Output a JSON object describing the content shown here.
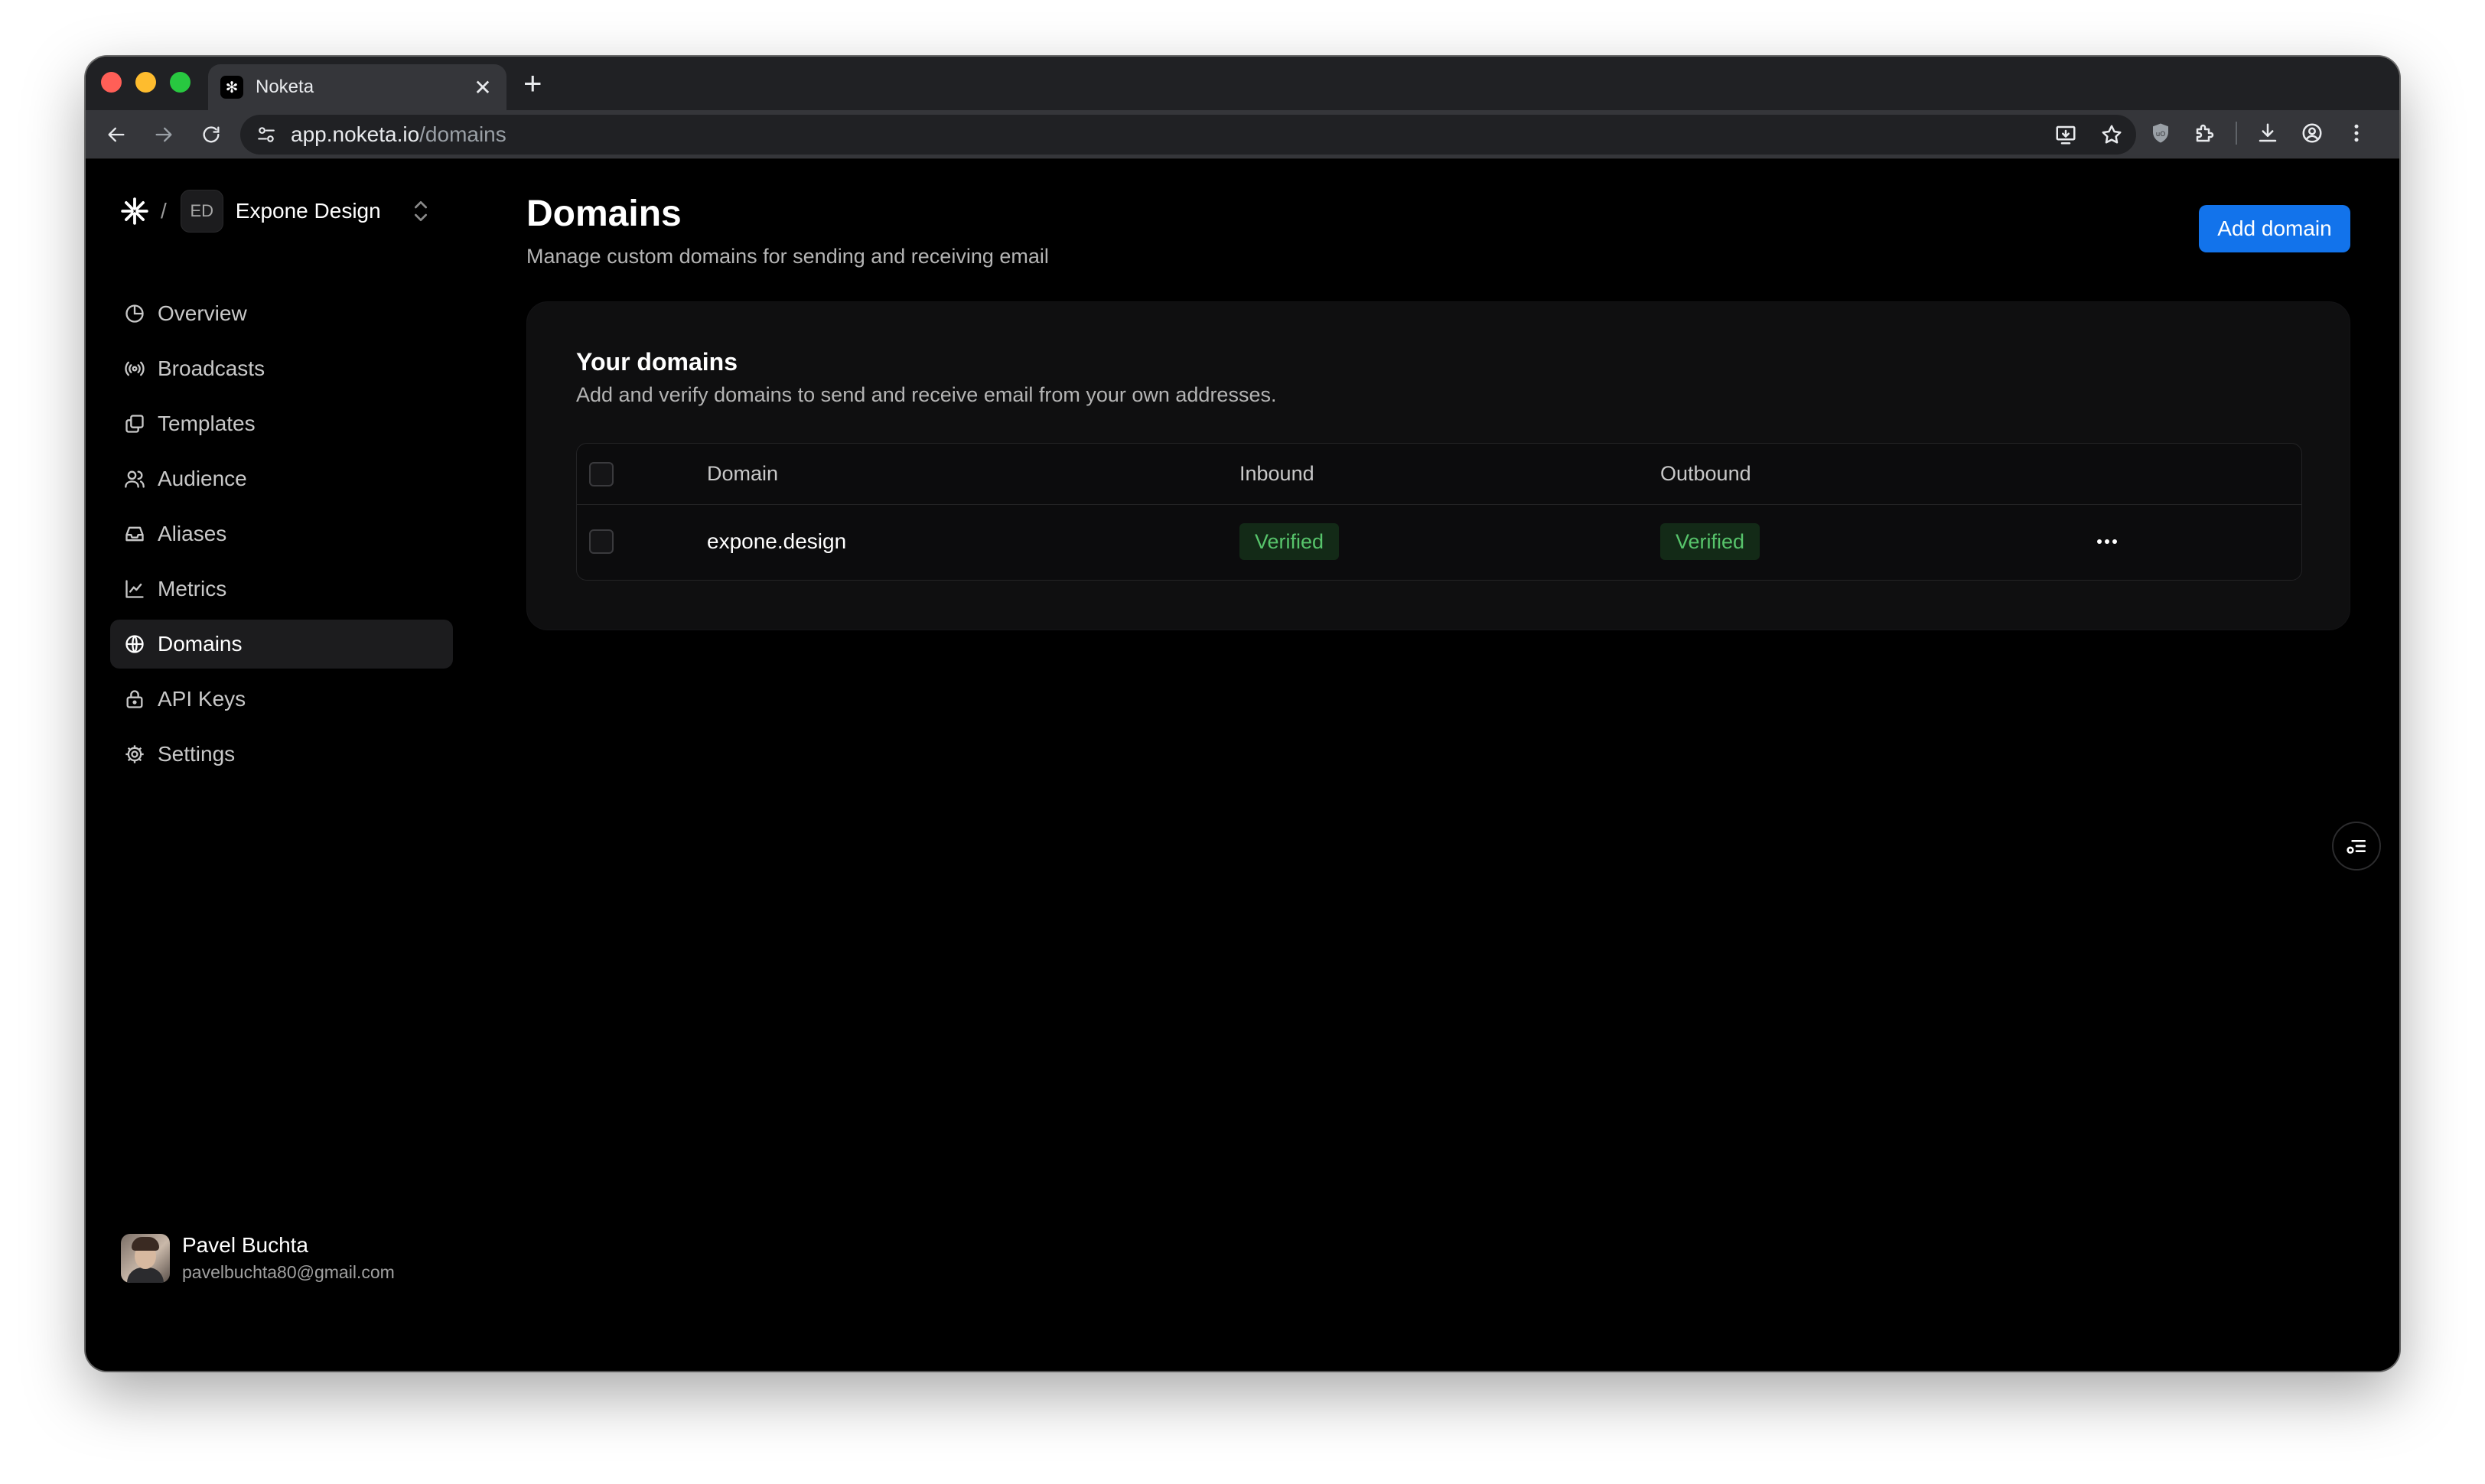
{
  "browser": {
    "tab_title": "Noketa",
    "tab_favicon": "noketa-logo-icon",
    "url_host": "app.noketa.io",
    "url_path": "/domains",
    "traffic_lights": {
      "close": "#ff5f57",
      "minimize": "#febc2e",
      "maximize": "#28c840"
    }
  },
  "sidebar": {
    "workspace_separator": "/",
    "workspace_badge": "ED",
    "workspace_name": "Expone Design",
    "items": [
      {
        "label": "Overview",
        "icon": "pie-chart-icon"
      },
      {
        "label": "Broadcasts",
        "icon": "broadcast-icon"
      },
      {
        "label": "Templates",
        "icon": "templates-icon"
      },
      {
        "label": "Audience",
        "icon": "users-icon"
      },
      {
        "label": "Aliases",
        "icon": "inbox-icon"
      },
      {
        "label": "Metrics",
        "icon": "chart-icon"
      },
      {
        "label": "Domains",
        "icon": "globe-icon",
        "active": true
      },
      {
        "label": "API Keys",
        "icon": "lock-icon"
      },
      {
        "label": "Settings",
        "icon": "gear-icon"
      }
    ],
    "user": {
      "name": "Pavel Buchta",
      "email": "pavelbuchta80@gmail.com"
    }
  },
  "main": {
    "title": "Domains",
    "subtitle": "Manage custom domains for sending and receiving email",
    "add_button": "Add domain",
    "card": {
      "title": "Your domains",
      "subtitle": "Add and verify domains to send and receive email from your own addresses.",
      "columns": [
        "Domain",
        "Inbound",
        "Outbound"
      ],
      "rows": [
        {
          "domain": "expone.design",
          "inbound": "Verified",
          "outbound": "Verified"
        }
      ]
    }
  },
  "colors": {
    "accent": "#1273eb",
    "verified_text": "#57c46b",
    "verified_bg": "#132a17",
    "background": "#000000"
  }
}
